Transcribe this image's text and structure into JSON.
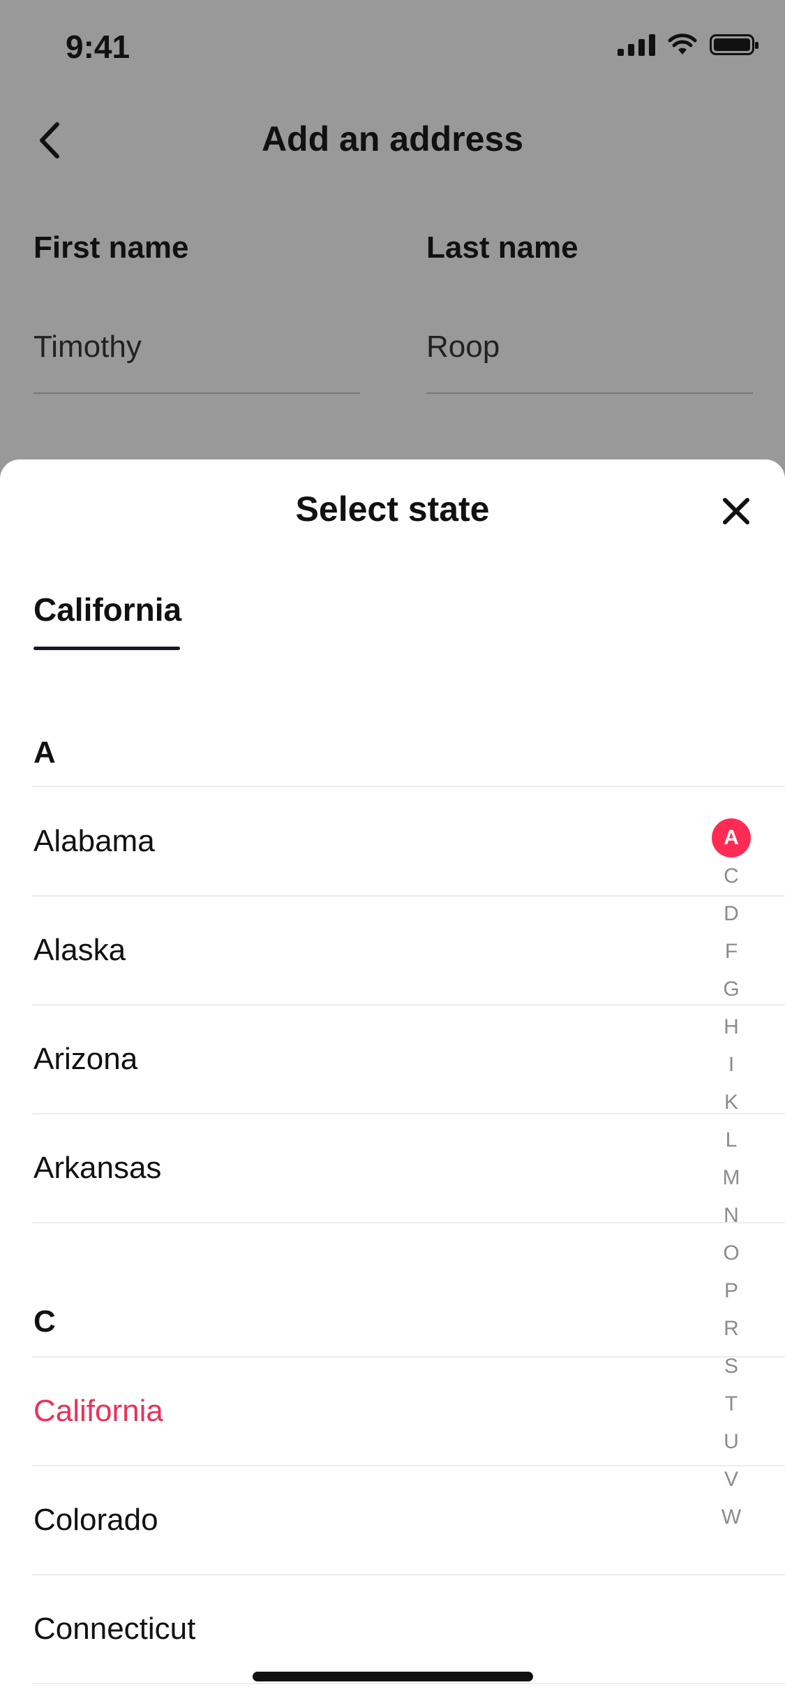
{
  "status_bar": {
    "time": "9:41"
  },
  "header": {
    "title": "Add an address"
  },
  "form": {
    "first_name_label": "First name",
    "first_name_value": "Timothy",
    "last_name_label": "Last name",
    "last_name_value": "Roop"
  },
  "sheet": {
    "title": "Select state",
    "selected_tab": "California",
    "sections": [
      {
        "letter": "A",
        "states": [
          "Alabama",
          "Alaska",
          "Arizona",
          "Arkansas"
        ]
      },
      {
        "letter": "C",
        "states": [
          "California",
          "Colorado",
          "Connecticut"
        ]
      }
    ],
    "selected_state": "California",
    "index_letters": [
      "A",
      "C",
      "D",
      "F",
      "G",
      "H",
      "I",
      "K",
      "L",
      "M",
      "N",
      "O",
      "P",
      "R",
      "S",
      "T",
      "U",
      "V",
      "W"
    ],
    "active_index": "A"
  },
  "colors": {
    "accent": "#fe2c55",
    "selected_text": "#e8325a",
    "overlay": "#999999"
  },
  "icons": {
    "back": "chevron-left-icon",
    "close": "close-icon",
    "signal": "cellular-signal-icon",
    "wifi": "wifi-icon",
    "battery": "battery-icon"
  }
}
